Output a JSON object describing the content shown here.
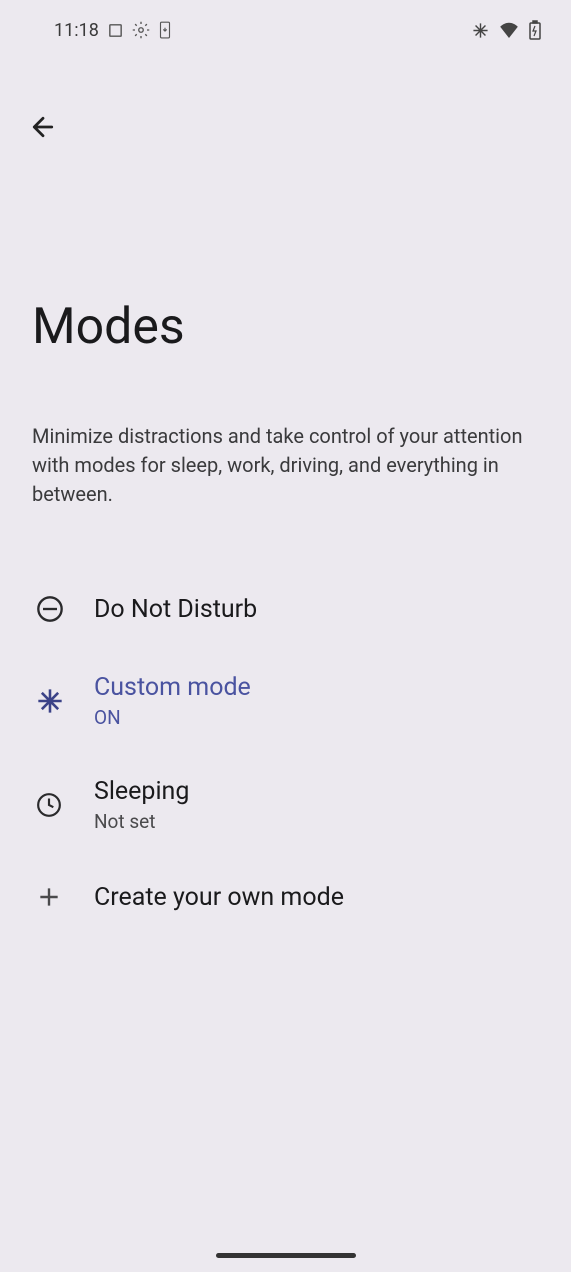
{
  "status_bar": {
    "time": "11:18"
  },
  "page": {
    "title": "Modes",
    "description": "Minimize distractions and take control of your attention with modes for sleep, work, driving, and everything in between."
  },
  "modes": [
    {
      "label": "Do Not Disturb",
      "status": "",
      "icon": "dnd"
    },
    {
      "label": "Custom mode",
      "status": "ON",
      "icon": "snowflake",
      "active": true
    },
    {
      "label": "Sleeping",
      "status": "Not set",
      "icon": "clock"
    },
    {
      "label": "Create your own mode",
      "status": "",
      "icon": "plus"
    }
  ]
}
